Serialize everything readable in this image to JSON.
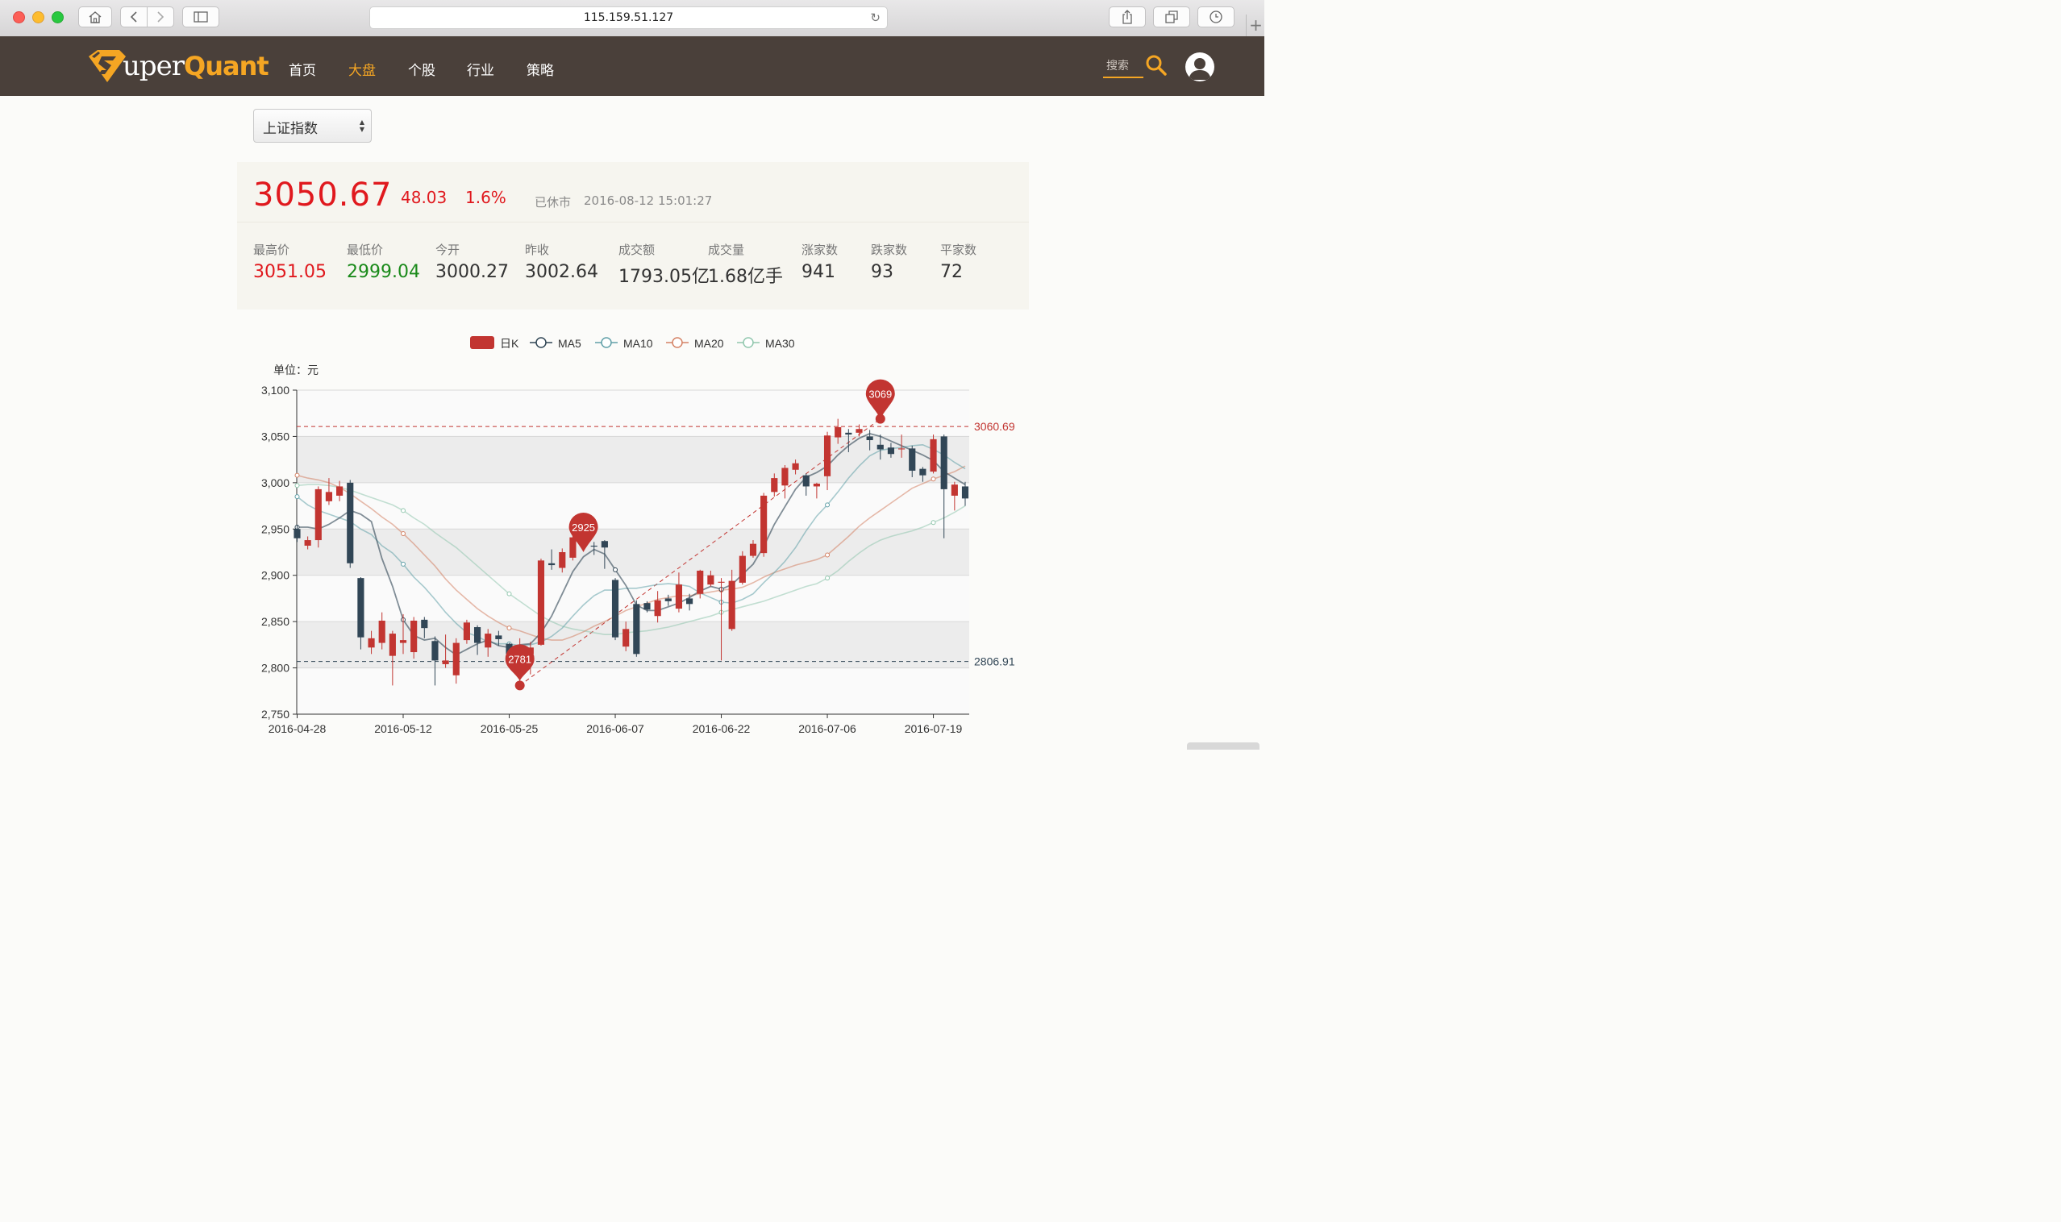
{
  "browser": {
    "url": "115.159.51.127"
  },
  "nav": {
    "logo_prefix": "uper",
    "logo_suffix": "Quant",
    "items": [
      {
        "label": "首页",
        "active": false
      },
      {
        "label": "大盘",
        "active": true
      },
      {
        "label": "个股",
        "active": false
      },
      {
        "label": "行业",
        "active": false
      },
      {
        "label": "策略",
        "active": false
      }
    ],
    "search_placeholder": "搜索"
  },
  "selector": {
    "selected": "上证指数"
  },
  "quote": {
    "price": "3050.67",
    "change": "48.03",
    "change_pct": "1.6%",
    "status": "已休市",
    "timestamp": "2016-08-12 15:01:27",
    "stats": [
      {
        "label": "最高价",
        "value": "3051.05",
        "color": "#e0191e"
      },
      {
        "label": "最低价",
        "value": "2999.04",
        "color": "#1a8a1a"
      },
      {
        "label": "今开",
        "value": "3000.27",
        "color": "#333333"
      },
      {
        "label": "昨收",
        "value": "3002.64",
        "color": "#333333"
      },
      {
        "label": "成交额",
        "value": "1793.05亿",
        "color": "#333333"
      },
      {
        "label": "成交量",
        "value": "1.68亿手",
        "color": "#333333"
      },
      {
        "label": "涨家数",
        "value": "941",
        "color": "#333333"
      },
      {
        "label": "跌家数",
        "value": "93",
        "color": "#333333"
      },
      {
        "label": "平家数",
        "value": "72",
        "color": "#333333"
      }
    ]
  },
  "chart_data": {
    "type": "candlestick",
    "unit_label": "单位：元",
    "legend": [
      "日K",
      "MA5",
      "MA10",
      "MA20",
      "MA30"
    ],
    "colors": {
      "up": "#c23531",
      "down": "#314656",
      "ma5": "#2f4554",
      "ma10": "#61a0a8",
      "ma20": "#d48265",
      "ma30": "#91c7ae"
    },
    "ylim": [
      2750,
      3100
    ],
    "yticks": [
      "2,750",
      "2,800",
      "2,850",
      "2,900",
      "2,950",
      "3,000",
      "3,050",
      "3,100"
    ],
    "xtick_labels": [
      "2016-04-28",
      "2016-05-12",
      "2016-05-25",
      "2016-06-07",
      "2016-06-22",
      "2016-07-06",
      "2016-07-19"
    ],
    "xtick_index": [
      0,
      10,
      20,
      30,
      40,
      50,
      60
    ],
    "markers": [
      {
        "label": "3069",
        "index": 55,
        "value": 3069
      },
      {
        "label": "2925",
        "index": 27,
        "value": 2925
      },
      {
        "label": "2781",
        "index": 21,
        "value": 2781
      }
    ],
    "reference_lines": [
      {
        "label": "3060.69",
        "value": 3060.69,
        "color": "#c23531"
      },
      {
        "label": "2806.91",
        "value": 2806.91,
        "color": "#314656"
      }
    ],
    "trend_line": {
      "from": {
        "index": 21,
        "value": 2781
      },
      "to": {
        "index": 55,
        "value": 3069
      }
    },
    "candles": [
      [
        2950,
        2940,
        2936,
        2954
      ],
      [
        2932,
        2938,
        2928,
        2942
      ],
      [
        2938,
        2993,
        2930,
        2996
      ],
      [
        2980,
        2990,
        2976,
        3005
      ],
      [
        2986,
        2996,
        2980,
        3002
      ],
      [
        3000,
        2913,
        2908,
        3003
      ],
      [
        2897,
        2833,
        2820,
        2898
      ],
      [
        2822,
        2832,
        2815,
        2840
      ],
      [
        2827,
        2851,
        2820,
        2860
      ],
      [
        2813,
        2837,
        2781,
        2840
      ],
      [
        2827,
        2830,
        2815,
        2858
      ],
      [
        2817,
        2851,
        2810,
        2855
      ],
      [
        2852,
        2843,
        2832,
        2855
      ],
      [
        2829,
        2808,
        2781,
        2834
      ],
      [
        2804,
        2808,
        2800,
        2836
      ],
      [
        2792,
        2827,
        2783,
        2832
      ],
      [
        2830,
        2849,
        2826,
        2852
      ],
      [
        2844,
        2827,
        2814,
        2846
      ],
      [
        2822,
        2837,
        2812,
        2842
      ],
      [
        2835,
        2831,
        2824,
        2840
      ],
      [
        2826,
        2815,
        2810,
        2827
      ],
      [
        2816,
        2822,
        2781,
        2832
      ],
      [
        2815,
        2822,
        2793,
        2828
      ],
      [
        2825,
        2916,
        2824,
        2918
      ],
      [
        2913,
        2911,
        2906,
        2928
      ],
      [
        2908,
        2925,
        2903,
        2929
      ],
      [
        2919,
        2941,
        2916,
        2946
      ],
      [
        2943,
        2936,
        2930,
        2948
      ],
      [
        2932,
        2931,
        2922,
        2936
      ],
      [
        2937,
        2930,
        2907,
        2938
      ],
      [
        2895,
        2833,
        2830,
        2897
      ],
      [
        2823,
        2842,
        2818,
        2850
      ],
      [
        2869,
        2815,
        2812,
        2873
      ],
      [
        2870,
        2863,
        2860,
        2872
      ],
      [
        2856,
        2873,
        2849,
        2883
      ],
      [
        2875,
        2872,
        2867,
        2879
      ],
      [
        2864,
        2890,
        2860,
        2903
      ],
      [
        2875,
        2869,
        2862,
        2880
      ],
      [
        2880,
        2905,
        2875,
        2906
      ],
      [
        2890,
        2900,
        2888,
        2905
      ],
      [
        2892,
        2893,
        2808,
        2897
      ],
      [
        2842,
        2894,
        2840,
        2906
      ],
      [
        2892,
        2921,
        2890,
        2926
      ],
      [
        2921,
        2934,
        2919,
        2938
      ],
      [
        2924,
        2986,
        2920,
        2989
      ],
      [
        2990,
        3005,
        2985,
        3010
      ],
      [
        2997,
        3016,
        2983,
        3019
      ],
      [
        3014,
        3021,
        3009,
        3025
      ],
      [
        3008,
        2996,
        2986,
        3010
      ],
      [
        2996,
        2999,
        2983,
        3000
      ],
      [
        3007,
        3051,
        2992,
        3055
      ],
      [
        3049,
        3060,
        3042,
        3069
      ],
      [
        3054,
        3052,
        3033,
        3058
      ],
      [
        3054,
        3058,
        3050,
        3063
      ],
      [
        3050,
        3046,
        3035,
        3057
      ],
      [
        3041,
        3036,
        3025,
        3052
      ],
      [
        3038,
        3031,
        3027,
        3043
      ],
      [
        3036,
        3037,
        3027,
        3052
      ],
      [
        3037,
        3013,
        3006,
        3040
      ],
      [
        3015,
        3008,
        3001,
        3017
      ],
      [
        3012,
        3047,
        3010,
        3052
      ],
      [
        3050,
        2993,
        2940,
        3052
      ],
      [
        2986,
        2998,
        2970,
        3001
      ],
      [
        2996,
        2983,
        2975,
        3001
      ]
    ],
    "ma5": [
      2952,
      2952,
      2950,
      2955,
      2962,
      2970,
      2966,
      2958,
      2918,
      2888,
      2852,
      2835,
      2830,
      2832,
      2822,
      2814,
      2820,
      2826,
      2830,
      2824,
      2822,
      2825,
      2826,
      2838,
      2856,
      2880,
      2904,
      2920,
      2928,
      2923,
      2906,
      2889,
      2868,
      2862,
      2862,
      2866,
      2870,
      2876,
      2883,
      2888,
      2885,
      2890,
      2901,
      2912,
      2931,
      2955,
      2974,
      2993,
      3006,
      3011,
      3018,
      3030,
      3040,
      3048,
      3053,
      3050,
      3045,
      3040,
      3035,
      3030,
      3024,
      3012,
      3005,
      2998
    ],
    "ma10": [
      2985,
      2976,
      2970,
      2966,
      2962,
      2958,
      2950,
      2944,
      2932,
      2924,
      2912,
      2898,
      2887,
      2874,
      2860,
      2848,
      2838,
      2834,
      2828,
      2826,
      2826,
      2824,
      2825,
      2828,
      2834,
      2843,
      2856,
      2868,
      2878,
      2884,
      2884,
      2886,
      2886,
      2888,
      2890,
      2891,
      2890,
      2888,
      2881,
      2876,
      2871,
      2870,
      2874,
      2880,
      2892,
      2903,
      2915,
      2930,
      2948,
      2964,
      2976,
      2990,
      3005,
      3018,
      3029,
      3035,
      3037,
      3038,
      3040,
      3041,
      3036,
      3030,
      3022,
      3015
    ],
    "ma20": [
      3008,
      3005,
      3003,
      3000,
      2995,
      2988,
      2980,
      2972,
      2963,
      2955,
      2945,
      2934,
      2922,
      2910,
      2896,
      2884,
      2874,
      2864,
      2856,
      2849,
      2843,
      2840,
      2836,
      2832,
      2830,
      2830,
      2834,
      2839,
      2845,
      2850,
      2856,
      2862,
      2866,
      2870,
      2874,
      2876,
      2878,
      2878,
      2880,
      2882,
      2884,
      2885,
      2887,
      2892,
      2898,
      2903,
      2907,
      2911,
      2914,
      2917,
      2922,
      2932,
      2942,
      2953,
      2962,
      2970,
      2978,
      2986,
      2994,
      2999,
      3004,
      3008,
      3012,
      3018
    ],
    "ma30": [
      2997,
      2998,
      2998,
      2997,
      2995,
      2992,
      2988,
      2984,
      2980,
      2976,
      2970,
      2962,
      2955,
      2946,
      2938,
      2930,
      2920,
      2910,
      2900,
      2890,
      2880,
      2872,
      2864,
      2856,
      2850,
      2845,
      2842,
      2840,
      2838,
      2836,
      2836,
      2838,
      2839,
      2840,
      2842,
      2844,
      2847,
      2850,
      2853,
      2856,
      2860,
      2863,
      2866,
      2869,
      2872,
      2876,
      2880,
      2884,
      2888,
      2891,
      2897,
      2905,
      2915,
      2924,
      2932,
      2938,
      2942,
      2945,
      2948,
      2952,
      2957,
      2962,
      2968,
      2975
    ]
  }
}
